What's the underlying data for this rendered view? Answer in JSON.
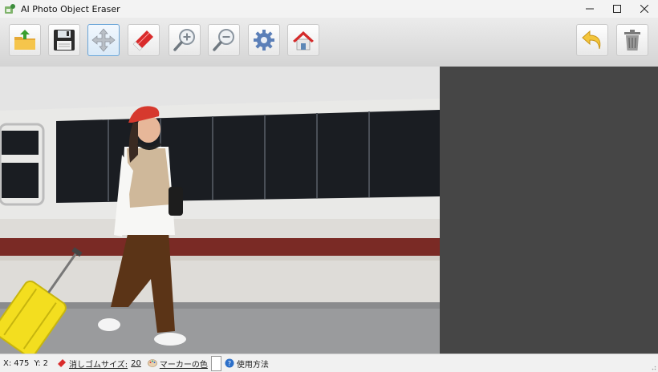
{
  "window": {
    "title": "AI Photo Object Eraser",
    "controls": {
      "minimize": "—",
      "maximize": "☐",
      "close": "✕"
    }
  },
  "toolbar": {
    "buttons": [
      {
        "id": "open",
        "icon": "open-folder-icon",
        "active": false
      },
      {
        "id": "save",
        "icon": "floppy-disk-icon",
        "active": false
      },
      {
        "id": "move",
        "icon": "move-arrows-icon",
        "active": true
      },
      {
        "id": "eraser",
        "icon": "eraser-icon",
        "active": false
      },
      {
        "id": "zoom-in",
        "icon": "zoom-in-icon",
        "active": false
      },
      {
        "id": "zoom-out",
        "icon": "zoom-out-icon",
        "active": false
      },
      {
        "id": "settings",
        "icon": "gear-icon",
        "active": false
      },
      {
        "id": "home",
        "icon": "home-icon",
        "active": false
      },
      {
        "id": "undo",
        "icon": "undo-arrow-icon",
        "active": false
      },
      {
        "id": "delete",
        "icon": "trash-icon",
        "active": false
      }
    ]
  },
  "image": {
    "description_icon": "photo-woman-with-suitcase"
  },
  "status": {
    "x_label": "X:",
    "x_value": "475",
    "y_label": "Y:",
    "y_value": "2",
    "eraser_size_label": "消しゴムサイズ:",
    "eraser_size_value": "20",
    "marker_color_label": "マーカーの色",
    "marker_color": "#ffffff",
    "help_label": "使用方法"
  },
  "colors": {
    "canvas_bg": "#464646",
    "toolbar_active_border": "#6aa5d8"
  }
}
